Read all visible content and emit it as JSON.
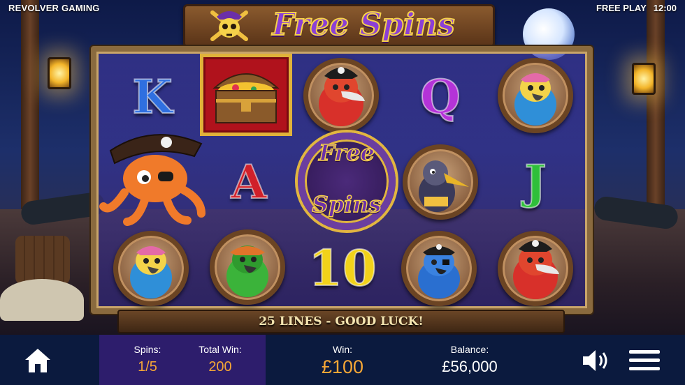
{
  "header": {
    "brand": "REVOLVER GAMING",
    "mode": "FREE PLAY",
    "time": "12:00",
    "title": "Free Spins"
  },
  "reels": {
    "col1": [
      "K",
      "pirate-octopus",
      "pink-parrot"
    ],
    "col2": [
      "treasure-chest",
      "A",
      "green-parrot"
    ],
    "col3": [
      "red-parrot",
      "free-spins-scatter",
      "10"
    ],
    "col4": [
      "Q",
      "pelican",
      "blue-parrot"
    ],
    "col5": [
      "pink-parrot",
      "J",
      "red-parrot"
    ],
    "scatter_text": [
      "Free",
      "Spins"
    ]
  },
  "banner": {
    "text": "25 LINES - GOOD LUCK!"
  },
  "footer": {
    "spins_label": "Spins:",
    "spins_value": "1/5",
    "total_win_label": "Total Win:",
    "total_win_value": "200",
    "win_label": "Win:",
    "win_value": "£100",
    "balance_label": "Balance:",
    "balance_value": "£56,000"
  },
  "colors": {
    "accent_orange": "#f5a636",
    "panel_purple": "#2d1d6c",
    "bar_navy": "#0b1a3e",
    "letter_K": "#2f6fe0",
    "letter_A": "#d0202a",
    "letter_10": "#f2d21a",
    "letter_Q": "#b433d8",
    "letter_J": "#2fbf3a"
  },
  "icons": [
    "home-icon",
    "speaker-icon",
    "hamburger-menu-icon"
  ]
}
